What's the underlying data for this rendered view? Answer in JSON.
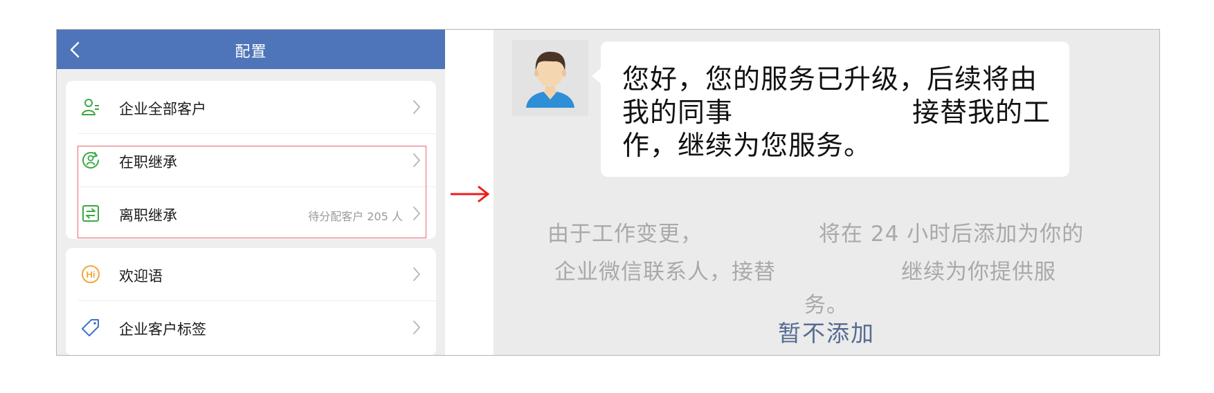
{
  "nav": {
    "title": "配置"
  },
  "menu": {
    "items": [
      {
        "label": "企业全部客户",
        "icon": "customer-icon"
      },
      {
        "label": "在职继承",
        "icon": "transfer-user-icon"
      },
      {
        "label": "离职继承",
        "icon": "exchange-icon",
        "extra": "待分配客户 205 人"
      },
      {
        "label": "欢迎语",
        "icon": "hi-icon"
      },
      {
        "label": "企业客户标签",
        "icon": "tag-icon"
      }
    ]
  },
  "chat": {
    "bubble_lines": [
      "您好，您的服务已升级，后续将由",
      "我的同事",
      "接替我的工",
      "作，继续为您服务。"
    ],
    "notice_lines": [
      "由于工作变更，",
      "将在 24 小时后添加为你的",
      "企业微信联系人，接替",
      "继续为你提供服",
      "务。"
    ],
    "skip_label": "暂不添加"
  },
  "colors": {
    "nav_bg": "#4e74b9",
    "icon_green": "#3aa845",
    "icon_orange": "#f2a63a",
    "icon_blue": "#3d72c4",
    "highlight": "#e9656f",
    "arrow": "#ee1c1c",
    "link": "#566b93"
  }
}
